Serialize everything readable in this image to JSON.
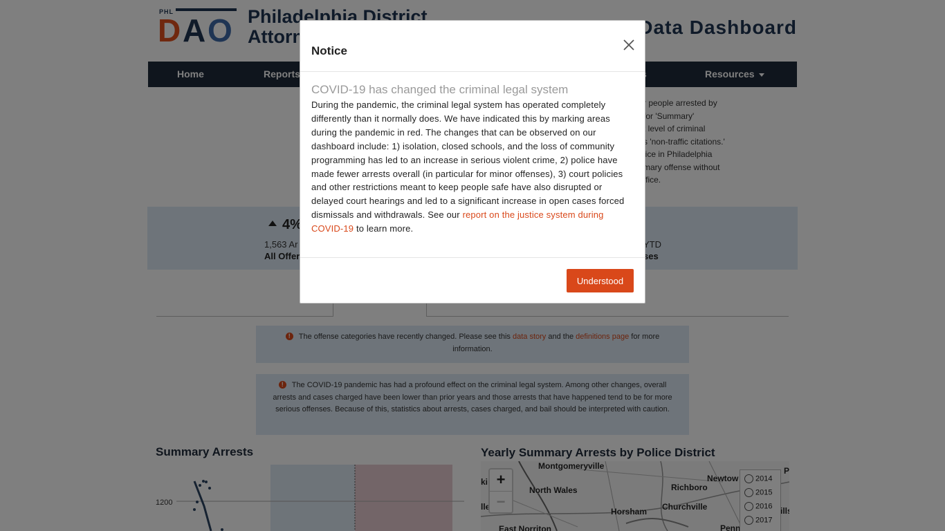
{
  "header": {
    "logo_phl": "PHL",
    "logo_letters": [
      "D",
      "A",
      "O"
    ],
    "org_name": "Philadelphia District Attorney's Office",
    "dashboard_title": "Data Dashboard"
  },
  "nav": {
    "items": [
      {
        "label": "Home"
      },
      {
        "label": "Reports"
      },
      {
        "label": "s"
      },
      {
        "label": "Resources"
      }
    ]
  },
  "intro": {
    "lines": [
      "r people arrested by",
      "for 'Summary'",
      "t level of criminal",
      "s 'non-traffic citations.'",
      "lice in Philadelphia",
      "mary offense without",
      "ffice."
    ]
  },
  "stats": {
    "change": "4%",
    "count": "1,563 Ar",
    "label": "All Offer",
    "count_right": "YTD",
    "label_right": "ses"
  },
  "alerts": {
    "categories": {
      "text_before": "The offense categories have recently changed. Please see this",
      "link1": "data story",
      "text_middle": "and the",
      "link2": "definitions page",
      "text_after": "for more information."
    },
    "covid": "The COVID-19 pandemic has had a profound effect on the criminal legal system. Among other changes, overall arrests and cases charged have been lower than prior years and those arrests that have happened tend to be for more serious offenses. Because of this, statistics about arrests, cases charged, and bail should be interpreted with caution."
  },
  "sections": {
    "chart_title": "Summary Arrests",
    "map_title": "Yearly Summary Arrests by Police District"
  },
  "chart_data": {
    "type": "line",
    "yticks": [
      "1200"
    ],
    "ytick_values": [
      1200
    ]
  },
  "map": {
    "labels": [
      "Montgomeryville",
      "North Wales",
      "Richboro",
      "Newtow",
      "Horsham",
      "Churchville",
      "East Norriton",
      "ki",
      "lle",
      "P",
      "ills",
      "Penn"
    ],
    "zoom_in": "+",
    "zoom_out": "−",
    "years": [
      "2014",
      "2015",
      "2016",
      "2017"
    ]
  },
  "modal": {
    "title": "Notice",
    "close_symbol": "×",
    "subtitle": "COVID-19 has changed the criminal legal system",
    "body": "During the pandemic, the criminal legal system has operated completely differently than it normally does. We have indicated this by marking areas during the pandemic in red. The changes that can be observed on our dashboard include: 1) isolation, closed schools, and the loss of community programming has led to an increase in serious violent crime, 2) police have made fewer arrests overall (in particular for minor offenses), 3) court policies and other restrictions meant to keep people safe have also disrupted or delayed court hearings and led to a significant increase in open cases forced dismissals and withdrawals. See our",
    "link": "report on the justice system during COVID-19",
    "body_end": "to learn more.",
    "button": "Understood"
  },
  "colors": {
    "brand_navy": "#1f2b3a",
    "accent_orange": "#d9481a",
    "logo_blue": "#3e6aa8",
    "alert_bg": "#dce9f5",
    "covid_red_band": "#e7cbd0",
    "pre_covid_band": "#dde8f2"
  }
}
